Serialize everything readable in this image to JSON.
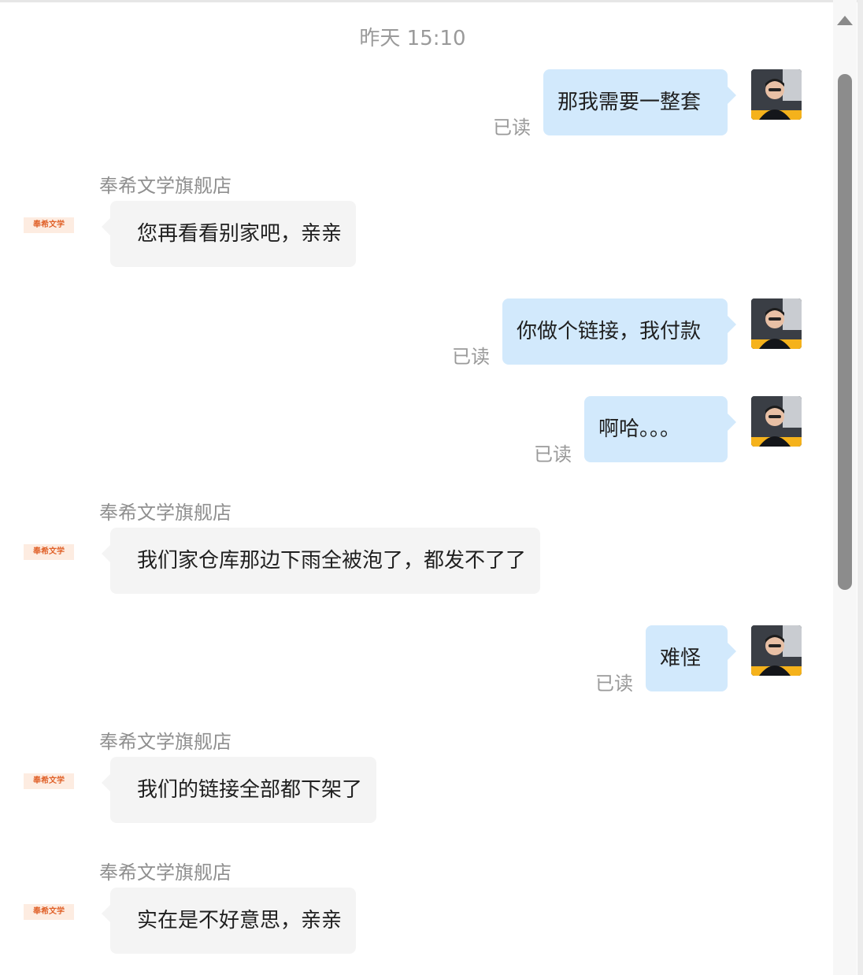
{
  "chat": {
    "timestamp": "昨天 15:10",
    "read_label": "已读",
    "shop_name": "奉希文学旗舰店",
    "shop_logo_text": "奉希文学",
    "messages": [
      {
        "direction": "out",
        "text": "那我需要一整套",
        "status": "已读"
      },
      {
        "direction": "in",
        "sender": "奉希文学旗舰店",
        "text": "您再看看别家吧，亲亲"
      },
      {
        "direction": "out",
        "text": "你做个链接，我付款",
        "status": "已读"
      },
      {
        "direction": "out",
        "text": "啊哈。。。",
        "status": "已读"
      },
      {
        "direction": "in",
        "sender": "奉希文学旗舰店",
        "text": "我们家仓库那边下雨全被泡了，都发不了了"
      },
      {
        "direction": "out",
        "text": "难怪",
        "status": "已读"
      },
      {
        "direction": "in",
        "sender": "奉希文学旗舰店",
        "text": "我们的链接全部都下架了"
      },
      {
        "direction": "in",
        "sender": "奉希文学旗舰店",
        "text": "实在是不好意思，亲亲"
      }
    ]
  },
  "icons": {
    "user_avatar": "user-avatar-photo",
    "shop_logo": "shop-logo-badge",
    "scroll_up": "chevron-up-icon"
  },
  "colors": {
    "outgoing_bubble": "#d2e9fc",
    "incoming_bubble": "#f4f4f4",
    "meta_text": "#9a9a9a",
    "shop_logo": "#e0622a"
  }
}
